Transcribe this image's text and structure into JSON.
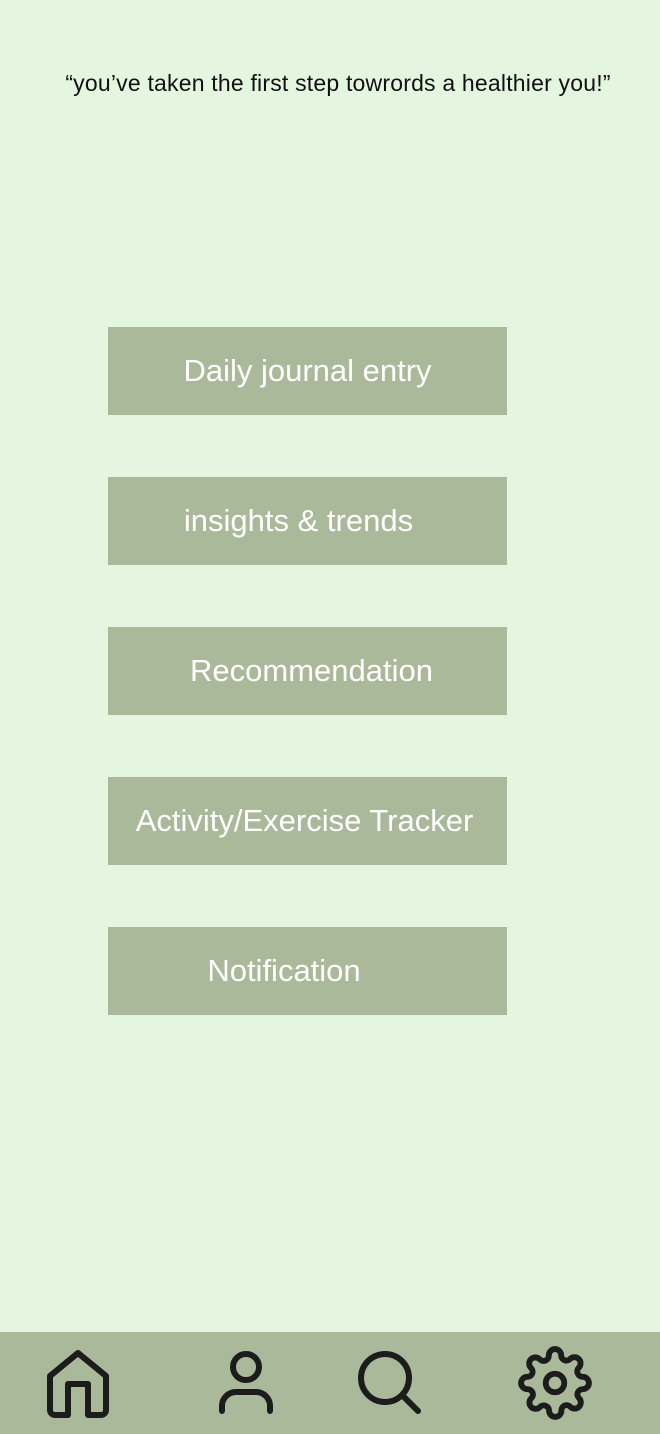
{
  "header": {
    "quote": "“you’ve taken the first step towrords a healthier you!”"
  },
  "menu": {
    "items": [
      {
        "label": "Daily journal entry"
      },
      {
        "label": "insights & trends"
      },
      {
        "label": "Recommendation"
      },
      {
        "label": "Activity/Exercise Tracker"
      },
      {
        "label": "Notification"
      }
    ]
  },
  "bottom_nav": {
    "items": [
      {
        "icon": "home-icon"
      },
      {
        "icon": "profile-icon"
      },
      {
        "icon": "search-icon"
      },
      {
        "icon": "settings-gear-icon"
      }
    ]
  },
  "colors": {
    "background": "#e4f6df",
    "button": "#aab99a",
    "nav_bar": "#aab99a",
    "button_text": "#ffffff",
    "icon": "#1c1c1c"
  }
}
